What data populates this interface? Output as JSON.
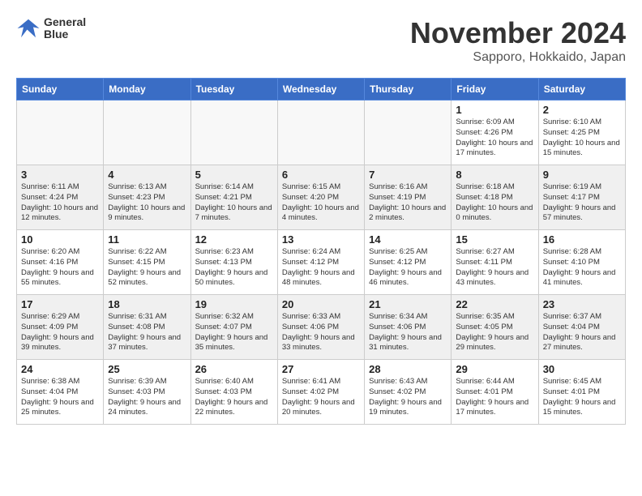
{
  "logo": {
    "line1": "General",
    "line2": "Blue"
  },
  "title": "November 2024",
  "subtitle": "Sapporo, Hokkaido, Japan",
  "days_of_week": [
    "Sunday",
    "Monday",
    "Tuesday",
    "Wednesday",
    "Thursday",
    "Friday",
    "Saturday"
  ],
  "weeks": [
    [
      {
        "day": "",
        "info": ""
      },
      {
        "day": "",
        "info": ""
      },
      {
        "day": "",
        "info": ""
      },
      {
        "day": "",
        "info": ""
      },
      {
        "day": "",
        "info": ""
      },
      {
        "day": "1",
        "info": "Sunrise: 6:09 AM\nSunset: 4:26 PM\nDaylight: 10 hours and 17 minutes."
      },
      {
        "day": "2",
        "info": "Sunrise: 6:10 AM\nSunset: 4:25 PM\nDaylight: 10 hours and 15 minutes."
      }
    ],
    [
      {
        "day": "3",
        "info": "Sunrise: 6:11 AM\nSunset: 4:24 PM\nDaylight: 10 hours and 12 minutes."
      },
      {
        "day": "4",
        "info": "Sunrise: 6:13 AM\nSunset: 4:23 PM\nDaylight: 10 hours and 9 minutes."
      },
      {
        "day": "5",
        "info": "Sunrise: 6:14 AM\nSunset: 4:21 PM\nDaylight: 10 hours and 7 minutes."
      },
      {
        "day": "6",
        "info": "Sunrise: 6:15 AM\nSunset: 4:20 PM\nDaylight: 10 hours and 4 minutes."
      },
      {
        "day": "7",
        "info": "Sunrise: 6:16 AM\nSunset: 4:19 PM\nDaylight: 10 hours and 2 minutes."
      },
      {
        "day": "8",
        "info": "Sunrise: 6:18 AM\nSunset: 4:18 PM\nDaylight: 10 hours and 0 minutes."
      },
      {
        "day": "9",
        "info": "Sunrise: 6:19 AM\nSunset: 4:17 PM\nDaylight: 9 hours and 57 minutes."
      }
    ],
    [
      {
        "day": "10",
        "info": "Sunrise: 6:20 AM\nSunset: 4:16 PM\nDaylight: 9 hours and 55 minutes."
      },
      {
        "day": "11",
        "info": "Sunrise: 6:22 AM\nSunset: 4:15 PM\nDaylight: 9 hours and 52 minutes."
      },
      {
        "day": "12",
        "info": "Sunrise: 6:23 AM\nSunset: 4:13 PM\nDaylight: 9 hours and 50 minutes."
      },
      {
        "day": "13",
        "info": "Sunrise: 6:24 AM\nSunset: 4:12 PM\nDaylight: 9 hours and 48 minutes."
      },
      {
        "day": "14",
        "info": "Sunrise: 6:25 AM\nSunset: 4:12 PM\nDaylight: 9 hours and 46 minutes."
      },
      {
        "day": "15",
        "info": "Sunrise: 6:27 AM\nSunset: 4:11 PM\nDaylight: 9 hours and 43 minutes."
      },
      {
        "day": "16",
        "info": "Sunrise: 6:28 AM\nSunset: 4:10 PM\nDaylight: 9 hours and 41 minutes."
      }
    ],
    [
      {
        "day": "17",
        "info": "Sunrise: 6:29 AM\nSunset: 4:09 PM\nDaylight: 9 hours and 39 minutes."
      },
      {
        "day": "18",
        "info": "Sunrise: 6:31 AM\nSunset: 4:08 PM\nDaylight: 9 hours and 37 minutes."
      },
      {
        "day": "19",
        "info": "Sunrise: 6:32 AM\nSunset: 4:07 PM\nDaylight: 9 hours and 35 minutes."
      },
      {
        "day": "20",
        "info": "Sunrise: 6:33 AM\nSunset: 4:06 PM\nDaylight: 9 hours and 33 minutes."
      },
      {
        "day": "21",
        "info": "Sunrise: 6:34 AM\nSunset: 4:06 PM\nDaylight: 9 hours and 31 minutes."
      },
      {
        "day": "22",
        "info": "Sunrise: 6:35 AM\nSunset: 4:05 PM\nDaylight: 9 hours and 29 minutes."
      },
      {
        "day": "23",
        "info": "Sunrise: 6:37 AM\nSunset: 4:04 PM\nDaylight: 9 hours and 27 minutes."
      }
    ],
    [
      {
        "day": "24",
        "info": "Sunrise: 6:38 AM\nSunset: 4:04 PM\nDaylight: 9 hours and 25 minutes."
      },
      {
        "day": "25",
        "info": "Sunrise: 6:39 AM\nSunset: 4:03 PM\nDaylight: 9 hours and 24 minutes."
      },
      {
        "day": "26",
        "info": "Sunrise: 6:40 AM\nSunset: 4:03 PM\nDaylight: 9 hours and 22 minutes."
      },
      {
        "day": "27",
        "info": "Sunrise: 6:41 AM\nSunset: 4:02 PM\nDaylight: 9 hours and 20 minutes."
      },
      {
        "day": "28",
        "info": "Sunrise: 6:43 AM\nSunset: 4:02 PM\nDaylight: 9 hours and 19 minutes."
      },
      {
        "day": "29",
        "info": "Sunrise: 6:44 AM\nSunset: 4:01 PM\nDaylight: 9 hours and 17 minutes."
      },
      {
        "day": "30",
        "info": "Sunrise: 6:45 AM\nSunset: 4:01 PM\nDaylight: 9 hours and 15 minutes."
      }
    ]
  ]
}
